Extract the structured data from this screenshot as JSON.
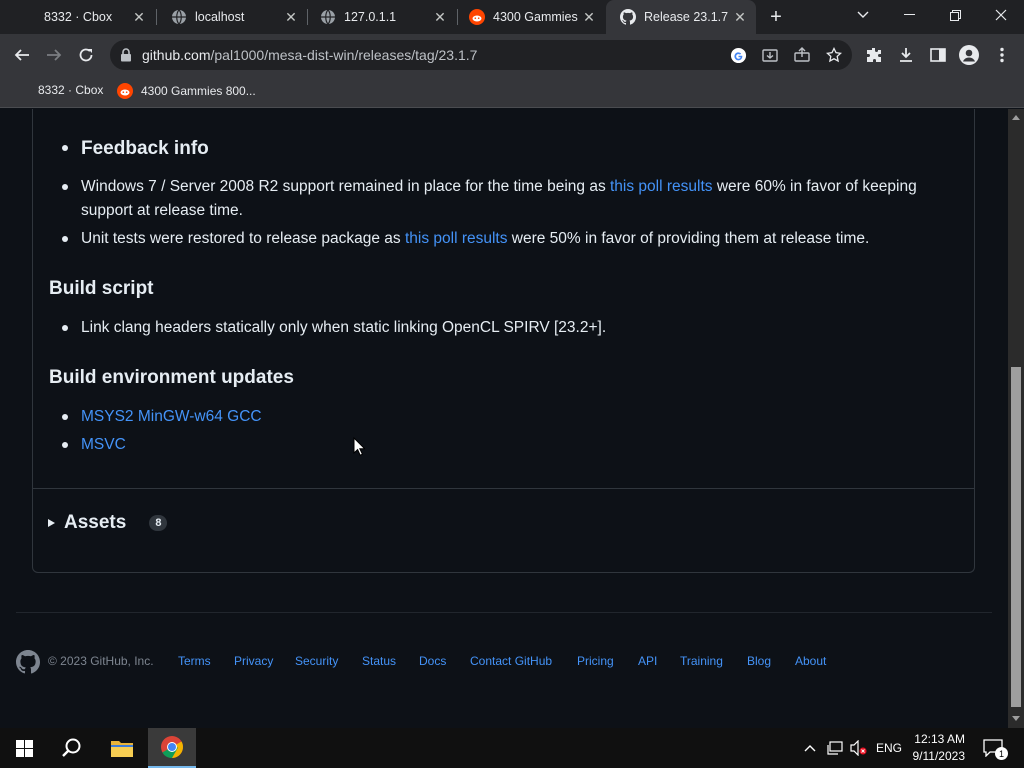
{
  "browser": {
    "tabs": [
      {
        "title": "8332 · Cbox",
        "favicon": "none",
        "active": false
      },
      {
        "title": "localhost",
        "favicon": "globe-icon",
        "active": false
      },
      {
        "title": "127.0.1.1",
        "favicon": "globe-icon",
        "active": false
      },
      {
        "title": "4300 Gammies",
        "favicon": "reddit-icon",
        "active": false
      },
      {
        "title": "Release 23.1.7 ·",
        "favicon": "github-icon",
        "active": true
      }
    ],
    "url_host": "github.com",
    "url_path": "/pal1000/mesa-dist-win/releases/tag/23.1.7",
    "bookmarks": [
      {
        "label": "8332 · Cbox",
        "icon": "none"
      },
      {
        "label": "4300 Gammies 800...",
        "icon": "reddit-icon"
      }
    ]
  },
  "release": {
    "feedback_heading": "Feedback info",
    "feedback_items": [
      {
        "pre": "Windows 7 / Server 2008 R2 support remained in place for the time being as ",
        "link": "this poll results",
        "post": " were 60% in favor of keeping",
        "line2": "support at release time."
      },
      {
        "pre": "Unit tests were restored to release package as ",
        "link": "this poll results",
        "post": " were 50% in favor of providing them at release time."
      }
    ],
    "build_script_heading": "Build script",
    "build_script_items": [
      "Link clang headers statically only when static linking OpenCL SPIRV [23.2+]."
    ],
    "build_env_heading": "Build environment updates",
    "build_env_items": [
      "MSYS2 MinGW-w64 GCC",
      "MSVC"
    ],
    "assets_label": "Assets",
    "assets_count": "8"
  },
  "footer": {
    "copyright": "© 2023 GitHub, Inc.",
    "links": [
      "Terms",
      "Privacy",
      "Security",
      "Status",
      "Docs",
      "Contact GitHub",
      "Pricing",
      "API",
      "Training",
      "Blog",
      "About"
    ]
  },
  "taskbar": {
    "language": "ENG",
    "time": "12:13 AM",
    "date": "9/11/2023",
    "notification_count": "1"
  },
  "colors": {
    "link": "#4493f8",
    "page_bg": "#0d1117",
    "border": "#30363d"
  }
}
